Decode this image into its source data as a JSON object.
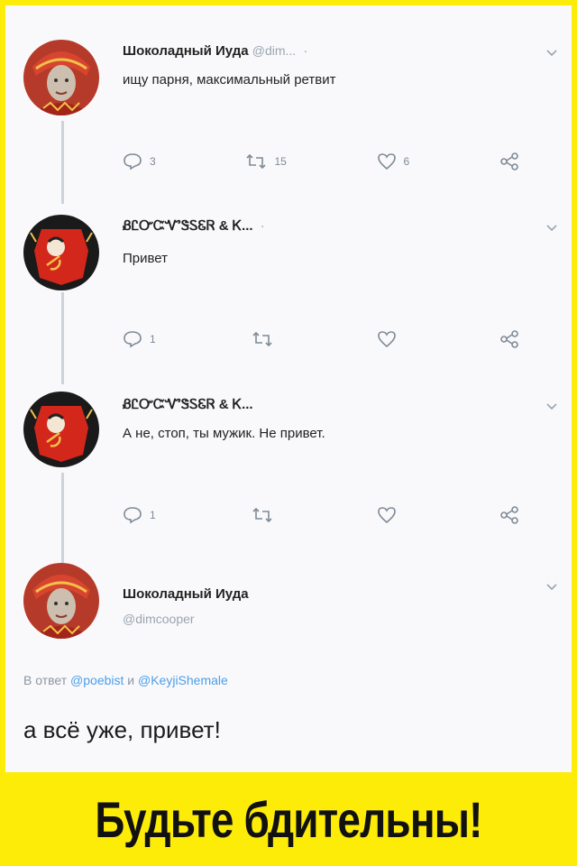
{
  "tweets": [
    {
      "name": "Шоколадный Иуда",
      "handle": "@dim...",
      "separator": "·",
      "text": "ищу парня, максимальный ретвит",
      "replies": "3",
      "retweets": "15",
      "likes": "6"
    },
    {
      "name": "ᏰᏝᏅᏨᏉᏕᏚᏋᏒ & Ꮶ...",
      "separator": "·",
      "text": "Привет",
      "replies": "1",
      "retweets": "",
      "likes": ""
    },
    {
      "name": "ᏰᏝᏅᏨᏉᏕᏚᏋᏒ & Ꮶ...",
      "text": "А не, стоп, ты мужик. Не привет.",
      "replies": "1",
      "retweets": "",
      "likes": ""
    }
  ],
  "final_tweet": {
    "name": "Шоколадный Иуда",
    "handle": "@dimcooper",
    "reply_prefix": "В ответ",
    "mention1": "@poebist",
    "and": "и",
    "mention2": "@KeyjiShemale",
    "text": "а всё уже, привет!"
  },
  "caption": "Будьте бдительны!",
  "colors": {
    "caption_bg": "#fdec07",
    "mention": "#4c9ee8",
    "muted": "#9aa5b1"
  },
  "icons": [
    "reply-icon",
    "retweet-icon",
    "like-icon",
    "share-icon",
    "chevron-down-icon"
  ]
}
